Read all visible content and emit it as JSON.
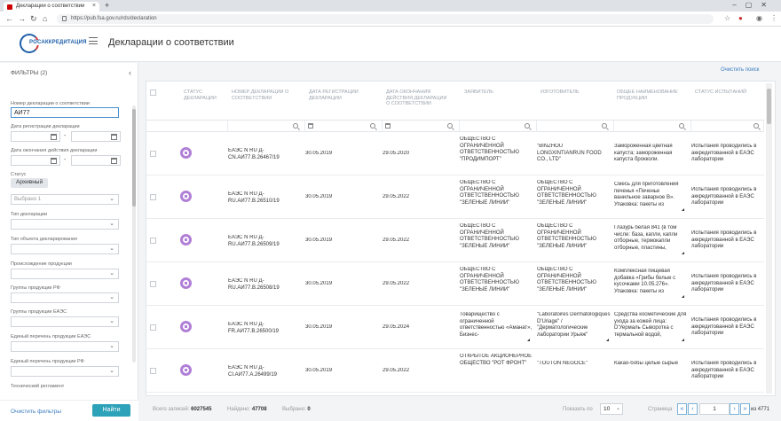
{
  "browser": {
    "tab_title": "Декларации о соответствии",
    "url": "https://pub.fsa.gov.ru/rds/declaration",
    "new_tab": "+",
    "close": "×"
  },
  "header": {
    "logo_text": "РОСАККРЕДИТАЦИЯ",
    "page_title": "Декларации о соответствии"
  },
  "sidebar": {
    "title": "ФИЛЬТРЫ (2)",
    "fields": {
      "decl_number_label": "Номер декларации о соответствии",
      "decl_number_value": "АИ77",
      "reg_date_label": "Дата регистрации декларации",
      "end_date_label": "Дата окончания действия декларации",
      "status_label": "Статус",
      "status_chip": "Архивный",
      "status_selected": "Выбрано 1",
      "decl_type_label": "Тип декларации",
      "object_type_label": "Тип объекта декларирования",
      "origin_label": "Происхождение продукции",
      "group_rf_label": "Группы продукции РФ",
      "group_eaes_label": "Группы продукции ЕАЭС",
      "list_eaes_label": "Единый перечень продукции ЕАЭС",
      "list_rf_label": "Единый перечень продукции РФ",
      "tech_reg_label": "Технический регламент"
    },
    "date_dash": "-",
    "clear_filters": "Очистить фильтры",
    "find_button": "Найти"
  },
  "main": {
    "clear_search": "Очистить поиск",
    "columns": [
      "Статус декларации",
      "Номер декларации о соответствии",
      "Дата регистрации декларации",
      "Дата окончания действия декларации о соответствии",
      "Заявитель",
      "Изготовитель",
      "Общее наименование продукции",
      "Статус испытаний"
    ],
    "rows": [
      {
        "number": "ЕАЭС N RU Д-CN.АИ77.В.26467/19",
        "reg_date": "30.05.2019",
        "end_date": "29.05.2020",
        "applicant": "ОБЩЕСТВО С ОГРАНИЧЕННОЙ ОТВЕТСТВЕННОСТЬЮ \"ПРОДИМПОРТ\"",
        "manufacturer": "\"BINZHOU LONGXINTIANRUN FOOD CO., LTD\"",
        "product": "Замороженная цветная капуста; замороженная капуста брокколи.",
        "tests": "Испытания проводились в аккредитованной в ЕАЭС лаборатории"
      },
      {
        "number": "ЕАЭС N RU Д-RU.АИ77.В.26510/19",
        "reg_date": "30.05.2019",
        "end_date": "29.05.2022",
        "applicant": "ОБЩЕСТВО С ОГРАНИЧЕННОЙ ОТВЕТСТВЕННОСТЬЮ \"ЗЕЛЕНЫЕ ЛИНИИ\"",
        "manufacturer": "ОБЩЕСТВО С ОГРАНИЧЕННОЙ ОТВЕТСТВЕННОСТЬЮ \"ЗЕЛЕНЫЕ ЛИНИИ\"",
        "product": "Смесь для приготовления печенья «Печенье ванильное заварное В». Упаковка: пакеты из",
        "tests": "Испытания проводились в аккредитованной в ЕАЭС лаборатории"
      },
      {
        "number": "ЕАЭС N RU Д-RU.АИ77.В.26509/19",
        "reg_date": "30.05.2019",
        "end_date": "29.05.2022",
        "applicant": "ОБЩЕСТВО С ОГРАНИЧЕННОЙ ОТВЕТСТВЕННОСТЬЮ \"ЗЕЛЕНЫЕ ЛИНИИ\"",
        "manufacturer": "ОБЩЕСТВО С ОГРАНИЧЕННОЙ ОТВЕТСТВЕННОСТЬЮ \"ЗЕЛЕНЫЕ ЛИНИИ\"",
        "product": "Глазурь белая 841 (в том числе: база, капли, капли отборные, термокапли отборные, пластины,",
        "tests": "Испытания проводились в аккредитованной в ЕАЭС лаборатории"
      },
      {
        "number": "ЕАЭС N RU Д-RU.АИ77.В.26508/19",
        "reg_date": "30.05.2019",
        "end_date": "29.05.2022",
        "applicant": "ОБЩЕСТВО С ОГРАНИЧЕННОЙ ОТВЕТСТВЕННОСТЬЮ \"ЗЕЛЕНЫЕ ЛИНИИ\"",
        "manufacturer": "ОБЩЕСТВО С ОГРАНИЧЕННОЙ ОТВЕТСТВЕННОСТЬЮ \"ЗЕЛЕНЫЕ ЛИНИИ\"",
        "product": "Комплексная пищевая добавка «Грибы белые с кусочками 10.05.276». Упаковка: пакеты из",
        "tests": "Испытания проводились в аккредитованной в ЕАЭС лаборатории"
      },
      {
        "number": "ЕАЭС N RU Д-FR.АИ77.В.26500/19",
        "reg_date": "30.05.2019",
        "end_date": "29.05.2024",
        "applicant": "Товарищество с ограниченной ответственностью «Аманат», Бизнес-",
        "manufacturer": "\"Laboratoires Dermatologiques D'Uriage\" / \"Дерматологические лаборатории Урьяж\"",
        "product": "Средства косметические для ухода за кожей лица: D'Уермаль Сыворотка с термальной водой,",
        "tests": "Испытания проводились в аккредитованной в ЕАЭС лаборатории"
      },
      {
        "number": "ЕАЭС N RU Д-CI.АИ77.А.26499/19",
        "reg_date": "30.05.2019",
        "end_date": "29.05.2022",
        "applicant": "ОТКРЫТОЕ АКЦИОНЕРНОЕ ОБЩЕСТВО \"РОТ ФРОНТ\"",
        "manufacturer": "\"TOUTON NEGOCE\"",
        "product": "Какао-бобы целые сырые",
        "tests": "Испытания проводились в аккредитованной в ЕАЭС лаборатории"
      }
    ]
  },
  "footer": {
    "total_label": "Всего записей:",
    "total_value": "6027545",
    "found_label": "Найдено:",
    "found_value": "47708",
    "selected_label": "Выбрано:",
    "selected_value": "0",
    "perpage_label": "Показать по",
    "perpage_value": "10",
    "page_label": "Страница",
    "page_value": "1",
    "page_of": "из 4771",
    "first": "«",
    "prev": "‹",
    "next": "›",
    "last": "»"
  }
}
